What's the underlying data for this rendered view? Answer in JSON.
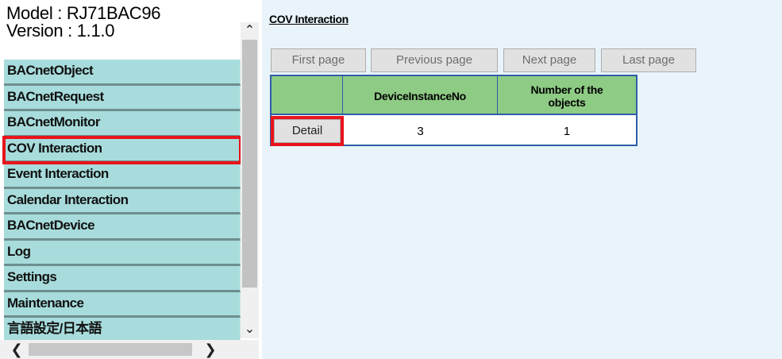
{
  "sidebar": {
    "model_line": "Model : RJ71BAC96",
    "version_line": "Version : 1.1.0",
    "items": [
      {
        "label": "BACnetObject"
      },
      {
        "label": "BACnetRequest"
      },
      {
        "label": "BACnetMonitor"
      },
      {
        "label": "COV Interaction",
        "selected": true
      },
      {
        "label": "Event Interaction"
      },
      {
        "label": "Calendar Interaction"
      },
      {
        "label": "BACnetDevice"
      },
      {
        "label": "Log"
      },
      {
        "label": "Settings"
      },
      {
        "label": "Maintenance"
      },
      {
        "label": "言語設定/日本語"
      }
    ],
    "vscroll": {
      "up": "⌃",
      "down": "⌄"
    },
    "hscroll": {
      "left": "❮",
      "right": "❯"
    }
  },
  "main": {
    "heading": "COV Interaction",
    "pager": {
      "first": "First page",
      "previous": "Previous page",
      "next": "Next page",
      "last": "Last page"
    },
    "table": {
      "headers": [
        "",
        "DeviceInstanceNo",
        "Number of the objects"
      ],
      "rows": [
        {
          "action": "Detail",
          "device_instance_no": "3",
          "number_of_objects": "1"
        }
      ]
    }
  },
  "colors": {
    "menu_bg": "#a8dcdc",
    "highlight": "#e8141b",
    "table_header": "#8ecb84",
    "table_border": "#2f5da8",
    "content_bg": "#e8f4fa"
  }
}
